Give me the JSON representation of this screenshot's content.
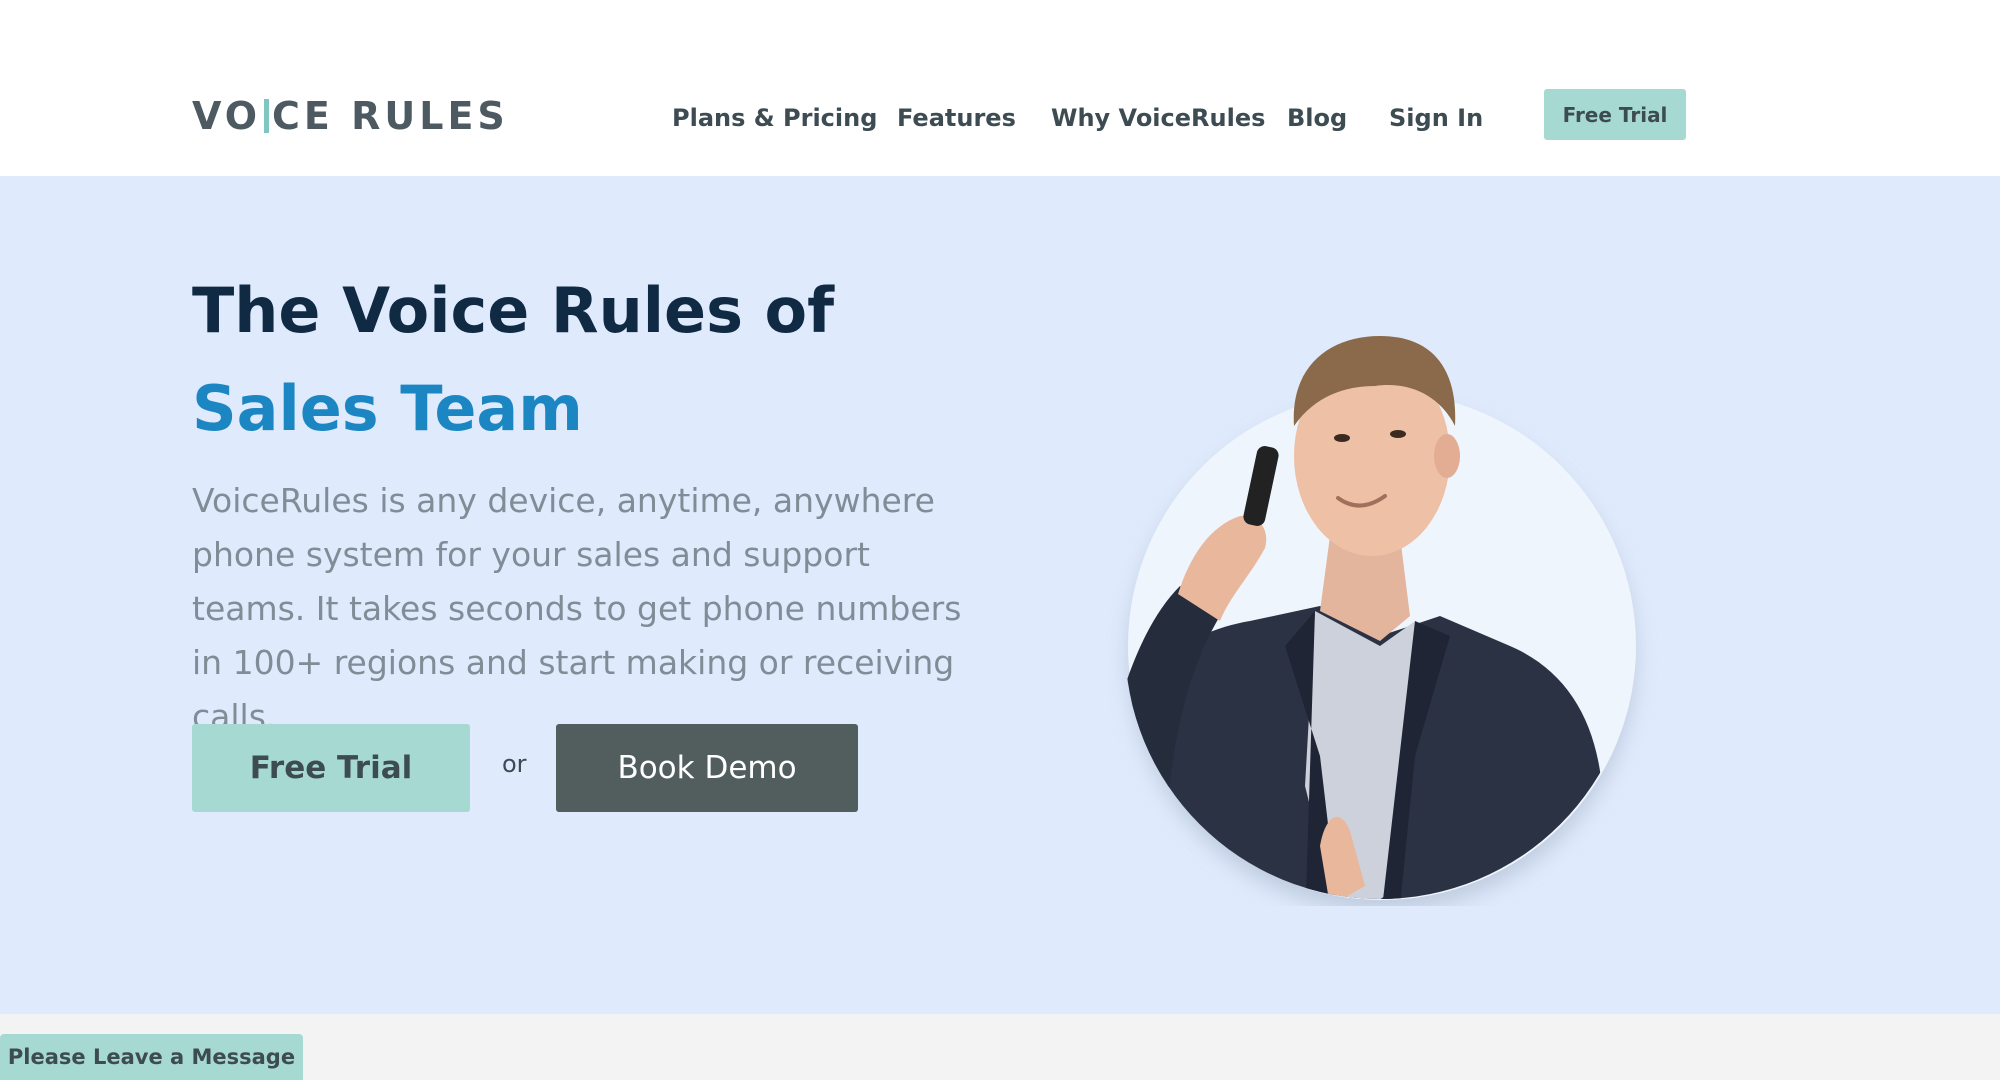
{
  "header": {
    "logo": {
      "text_left": "VO",
      "text_right": "CE RULES",
      "accent_color": "#7fc7c0"
    },
    "nav": [
      {
        "label": "Plans & Pricing"
      },
      {
        "label": "Features"
      },
      {
        "label": "Why VoiceRules"
      },
      {
        "label": "Blog"
      },
      {
        "label": "Sign In"
      }
    ],
    "cta_label": "Free Trial"
  },
  "hero": {
    "title": "The Voice Rules of",
    "title_accent": "Sales Team",
    "description": "VoiceRules is any device, anytime, anywhere phone system for your sales and support teams. It takes seconds to get phone numbers in 100+ regions and start making or receiving calls.",
    "primary_button": "Free Trial",
    "separator": "or",
    "secondary_button": "Book Demo"
  },
  "chat_widget": {
    "label": "Please Leave a Message"
  },
  "colors": {
    "hero_background": "#dfeafd",
    "accent_teal": "#a6d9d2",
    "accent_blue": "#1c86c3",
    "dark_button": "#525e5e"
  }
}
